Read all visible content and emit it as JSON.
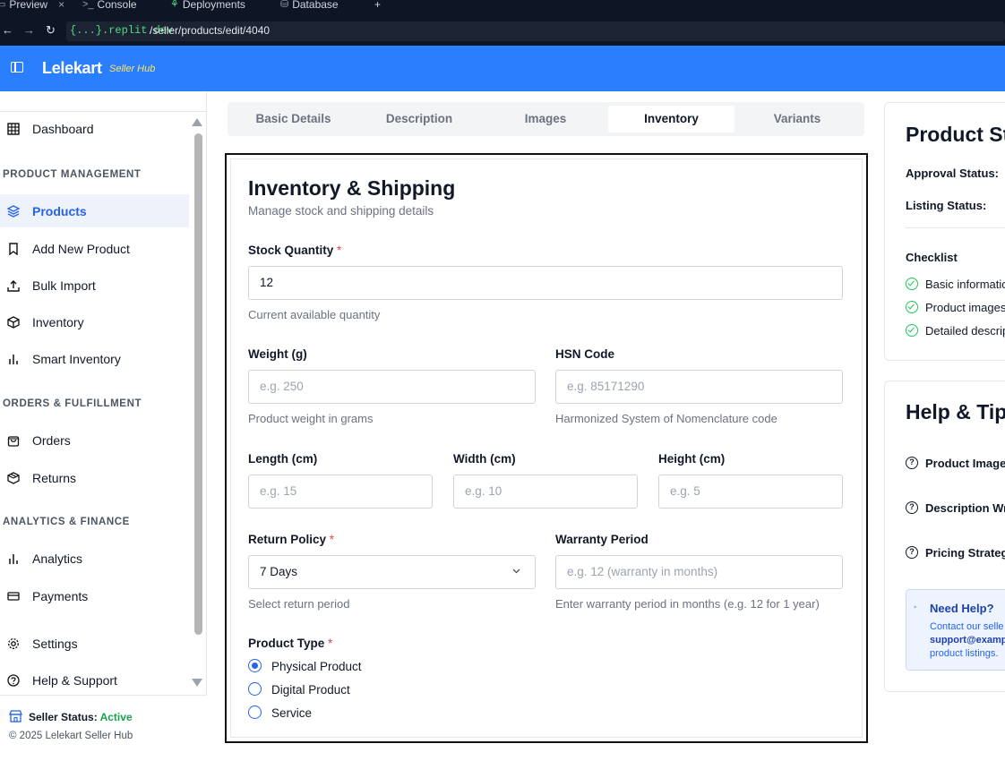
{
  "browser": {
    "tabs": [
      {
        "label": "Preview",
        "icon": "monitor-icon"
      },
      {
        "label": "Console",
        "icon": "terminal-icon"
      },
      {
        "label": "Deployments",
        "icon": "deploy-icon"
      },
      {
        "label": "Database",
        "icon": "database-icon"
      }
    ],
    "close_glyph": "×",
    "add_glyph": "+",
    "domain": "{...}.replit.dev",
    "path": "/seller/products/edit/4040"
  },
  "header": {
    "brand": "Lelekart",
    "sub": "Seller Hub",
    "color": "#2a7fff"
  },
  "sidebar": {
    "dashboard": "Dashboard",
    "section_product": "PRODUCT MANAGEMENT",
    "products": "Products",
    "add_new": "Add New Product",
    "bulk_import": "Bulk Import",
    "inventory": "Inventory",
    "smart_inventory": "Smart Inventory",
    "section_orders": "ORDERS & FULFILLMENT",
    "orders": "Orders",
    "returns": "Returns",
    "section_analytics": "ANALYTICS & FINANCE",
    "analytics": "Analytics",
    "payments": "Payments",
    "settings": "Settings",
    "help": "Help & Support",
    "status_label": "Seller Status:",
    "status_value": "Active",
    "copyright": "© 2025 Lelekart Seller Hub"
  },
  "tabs": [
    "Basic Details",
    "Description",
    "Images",
    "Inventory",
    "Variants"
  ],
  "form": {
    "title": "Inventory & Shipping",
    "subtitle": "Manage stock and shipping details",
    "stock_label": "Stock Quantity",
    "stock_value": "12",
    "stock_help": "Current available quantity",
    "weight_label": "Weight (g)",
    "weight_ph": "e.g. 250",
    "weight_help": "Product weight in grams",
    "hsn_label": "HSN Code",
    "hsn_ph": "e.g. 85171290",
    "hsn_help": "Harmonized System of Nomenclature code",
    "length_label": "Length (cm)",
    "length_ph": "e.g. 15",
    "width_label": "Width (cm)",
    "width_ph": "e.g. 10",
    "height_label": "Height (cm)",
    "height_ph": "e.g. 5",
    "return_label": "Return Policy",
    "return_value": "7 Days",
    "return_help": "Select return period",
    "warranty_label": "Warranty Period",
    "warranty_ph": "e.g. 12 (warranty in months)",
    "warranty_help": "Enter warranty period in months (e.g. 12 for 1 year)",
    "type_label": "Product Type",
    "types": [
      "Physical Product",
      "Digital Product",
      "Service"
    ],
    "selected_type": "Physical Product",
    "required_mark": "*"
  },
  "status_panel": {
    "title": "Product Sta",
    "approval": "Approval Status:",
    "listing": "Listing Status:",
    "checklist": "Checklist",
    "items": [
      "Basic informatio",
      "Product images",
      "Detailed descrip"
    ]
  },
  "help_panel": {
    "title": "Help & Tips",
    "items": [
      "Product Image",
      "Description Wr",
      "Pricing Strategy"
    ],
    "need_help": "Need Help?",
    "contact_line1": "Contact our selle",
    "contact_line2": "support@examp",
    "contact_line3": "product listings."
  }
}
